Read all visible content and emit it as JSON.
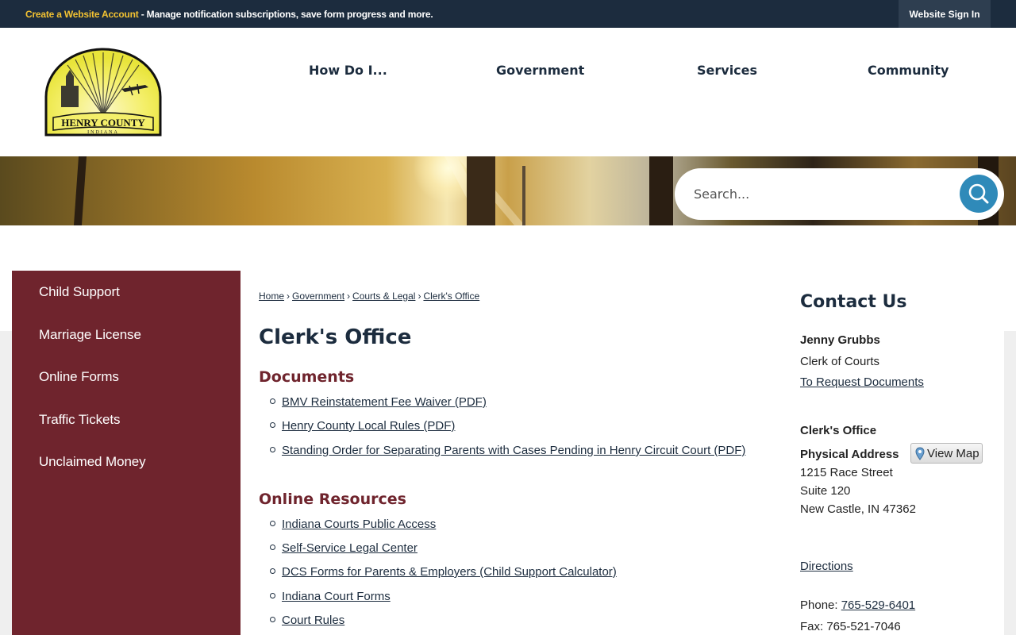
{
  "topbar": {
    "create_account": "Create a Website Account",
    "message": " - Manage notification subscriptions, save form progress and more.",
    "sign_in": "Website Sign In"
  },
  "header": {
    "logo_text": "HENRY COUNTY",
    "logo_subtext": "INDIANA",
    "nav": [
      "How Do I...",
      "Government",
      "Services",
      "Community"
    ]
  },
  "search": {
    "placeholder": "Search...",
    "icon": "search-icon"
  },
  "sidebar": {
    "items": [
      "Child Support",
      "Marriage License",
      "Online Forms",
      "Traffic Tickets",
      "Unclaimed Money"
    ]
  },
  "breadcrumb": [
    "Home",
    "Government",
    "Courts & Legal",
    "Clerk's Office"
  ],
  "page_title": "Clerk's Office",
  "documents": {
    "title": "Documents",
    "links": [
      "BMV Reinstatement Fee Waiver (PDF)",
      "Henry County Local Rules (PDF)",
      "Standing Order for Separating Parents with Cases Pending in Henry Circuit Court (PDF)"
    ]
  },
  "online_resources": {
    "title": "Online Resources",
    "links": [
      "Indiana Courts Public Access",
      "Self-Service Legal Center",
      "DCS Forms for Parents & Employers (Child Support Calculator)",
      "Indiana Court Forms",
      "Court Rules"
    ]
  },
  "contact": {
    "title": "Contact Us",
    "name": "Jenny Grubbs",
    "role": "Clerk of Courts",
    "request_link": "To Request Documents",
    "office": "Clerk's Office",
    "address_label": "Physical Address",
    "view_map": "View Map",
    "address_line1": "1215 Race Street",
    "address_line2": "Suite 120",
    "address_line3": "New Castle, IN 47362",
    "directions": "Directions",
    "phone_label": "Phone: ",
    "phone": "765-529-6401",
    "fax": "Fax: 765-521-7046"
  },
  "colors": {
    "topbar": "#1c2c3e",
    "accent_yellow": "#f2c232",
    "maroon": "#6f242d",
    "search_button": "#2f8ab9"
  }
}
